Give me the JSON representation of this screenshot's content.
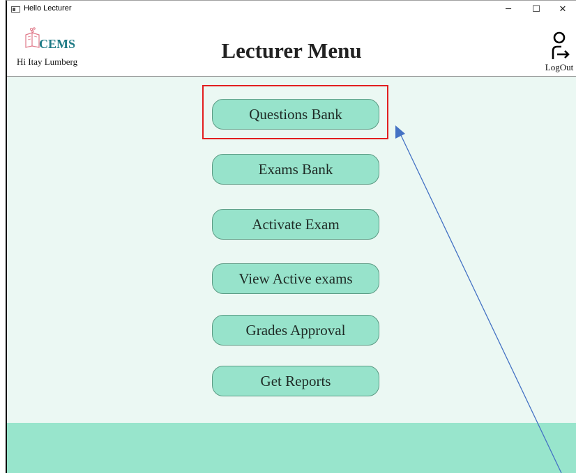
{
  "window": {
    "title": "Hello Lecturer",
    "minimize_glyph": "─",
    "maximize_glyph": "☐",
    "close_glyph": "✕"
  },
  "header": {
    "logo_text": "CEMS",
    "greeting": "Hi Itay Lumberg",
    "title": "Lecturer Menu",
    "logout_label": "LogOut"
  },
  "menu": {
    "items": [
      {
        "label": "Questions Bank"
      },
      {
        "label": "Exams Bank"
      },
      {
        "label": "Activate Exam"
      },
      {
        "label": "View Active exams"
      },
      {
        "label": "Grades Approval"
      },
      {
        "label": "Get Reports"
      }
    ]
  },
  "colors": {
    "content_bg": "#ebf8f3",
    "button_bg": "#97e3cb",
    "footer_bg": "#98e5cc",
    "logo_text": "#1d7a85",
    "highlight": "#e21f1f",
    "annotation_arrow": "#4472c4"
  }
}
